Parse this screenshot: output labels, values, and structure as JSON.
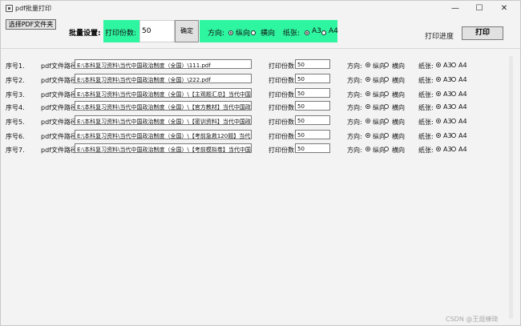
{
  "window": {
    "title": "pdf批量打印",
    "minimize_glyph": "—",
    "maximize_glyph": "☐",
    "close_glyph": "✕"
  },
  "toolbar": {
    "select_pdf_label": "选择PDF文件夹",
    "batch_label": "批量设置:",
    "copies_label": "打印份数:",
    "copies_value": "50",
    "confirm_label": "确定",
    "orientation_label": "方向:",
    "portrait_label": "纵向",
    "landscape_label": "横向",
    "paper_label": "纸张:",
    "a3_label": "A3",
    "a4_label": "A4",
    "orientation_selected": "portrait",
    "paper_selected": "A3",
    "progress_label": "打印进度",
    "print_label": "打印"
  },
  "row_labels": {
    "path_label": "pdf文件路径:",
    "copies_label": "打印份数:",
    "orientation_label": "方向:",
    "portrait_label": "纵向",
    "landscape_label": "横向",
    "paper_label": "纸张:",
    "a3_label": "A3",
    "a4_label": "A4"
  },
  "rows": [
    {
      "seq": "序号1.",
      "path": "E:\\本科复习资料\\当代中国政治制度（全国）\\111.pdf",
      "copies": "50"
    },
    {
      "seq": "序号2.",
      "path": "E:\\本科复习资料\\当代中国政治制度（全国）\\222.pdf",
      "copies": "50"
    },
    {
      "seq": "序号3.",
      "path": "E:\\本科复习资料\\当代中国政治制度（全国）\\【主观题汇总】当代中国政治",
      "copies": "50"
    },
    {
      "seq": "序号4.",
      "path": "E:\\本科复习资料\\当代中国政治制度（全国）\\【官方教材】当代中国政治制",
      "copies": "50"
    },
    {
      "seq": "序号5.",
      "path": "E:\\本科复习资料\\当代中国政治制度（全国）\\【密训资料】当代中国政治制",
      "copies": "50"
    },
    {
      "seq": "序号6.",
      "path": "E:\\本科复习资料\\当代中国政治制度（全国）\\【考前急救120题】当代中国",
      "copies": "50"
    },
    {
      "seq": "序号7.",
      "path": "E:\\本科复习资料\\当代中国政治制度（全国）\\【考前模拟卷】当代中国政治",
      "copies": "50"
    }
  ],
  "watermark": "CSDN @王焜棟琦",
  "colors": {
    "accent_green": "#2ef5a0",
    "window_bg": "#f3f3f3",
    "button_bg": "#e1e1e1"
  }
}
